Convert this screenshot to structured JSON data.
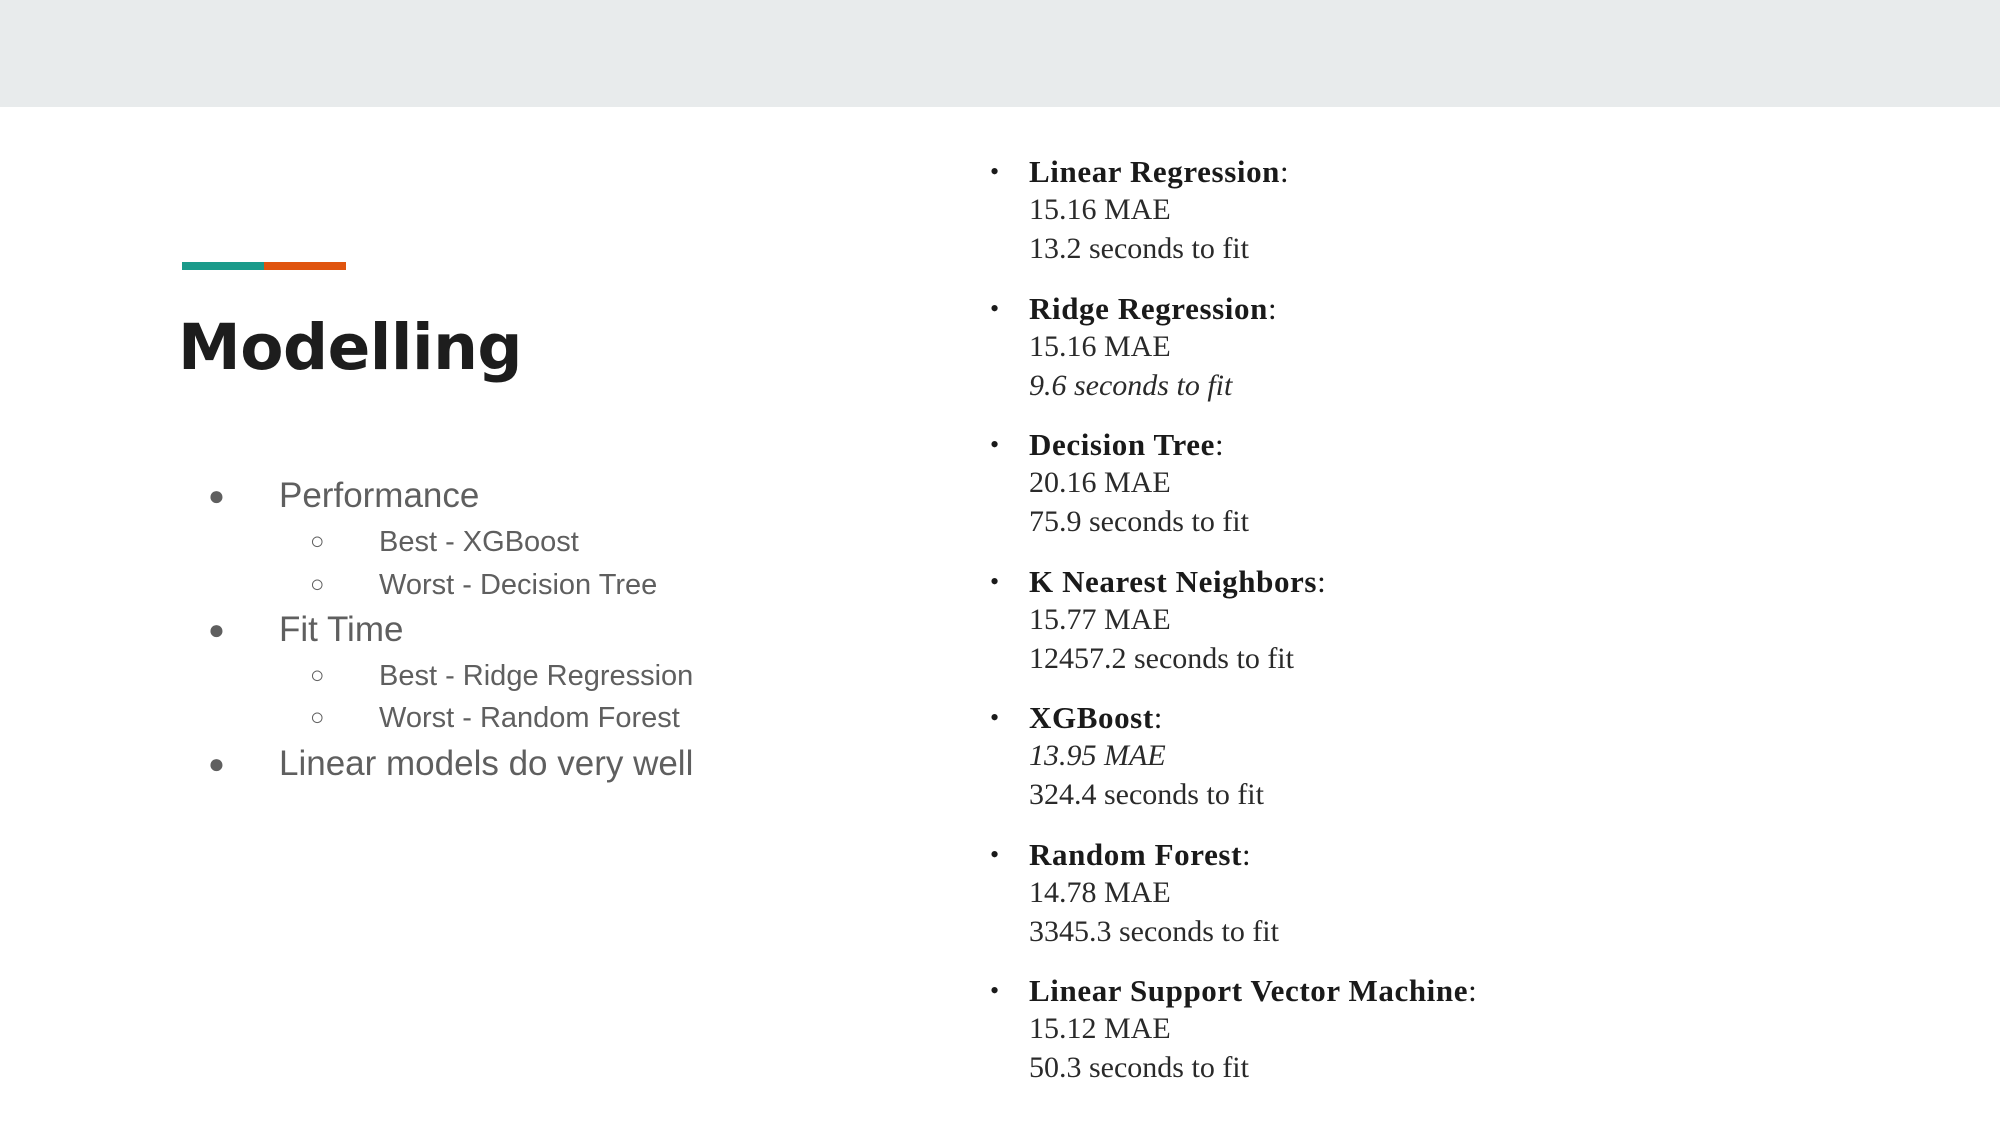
{
  "slide": {
    "title": "Modelling",
    "colors": {
      "band": "#e8ebec",
      "accent_teal": "#1a9a8a",
      "accent_orange": "#e0540e",
      "title": "#1d1d1d",
      "body": "#5f5f5f"
    },
    "summary": [
      {
        "text": "Performance",
        "children": [
          "Best - XGBoost",
          "Worst - Decision Tree"
        ]
      },
      {
        "text": "Fit Time",
        "children": [
          "Best - Ridge Regression",
          "Worst - Random Forest"
        ]
      },
      {
        "text": "Linear models do very well",
        "children": []
      }
    ],
    "bullet_l1": "●",
    "bullet_l2": "○",
    "bullet_models": "•",
    "models": [
      {
        "name": "Linear Regression",
        "mae": "15.16 MAE",
        "fit": "13.2 seconds to fit"
      },
      {
        "name": "Ridge Regression",
        "mae": "15.16 MAE",
        "fit": "9.6 seconds to fit"
      },
      {
        "name": "Decision Tree",
        "mae": "20.16 MAE",
        "fit": "75.9 seconds to fit"
      },
      {
        "name": "K Nearest Neighbors",
        "mae": "15.77 MAE",
        "fit": "12457.2 seconds to fit"
      },
      {
        "name": "XGBoost",
        "mae": "13.95 MAE",
        "fit": "324.4 seconds to fit"
      },
      {
        "name": "Random Forest",
        "mae": "14.78 MAE",
        "fit": "3345.3 seconds to fit"
      },
      {
        "name": "Linear Support Vector Machine",
        "mae": "15.12 MAE",
        "fit": "50.3 seconds to fit"
      }
    ],
    "colon": ":"
  }
}
